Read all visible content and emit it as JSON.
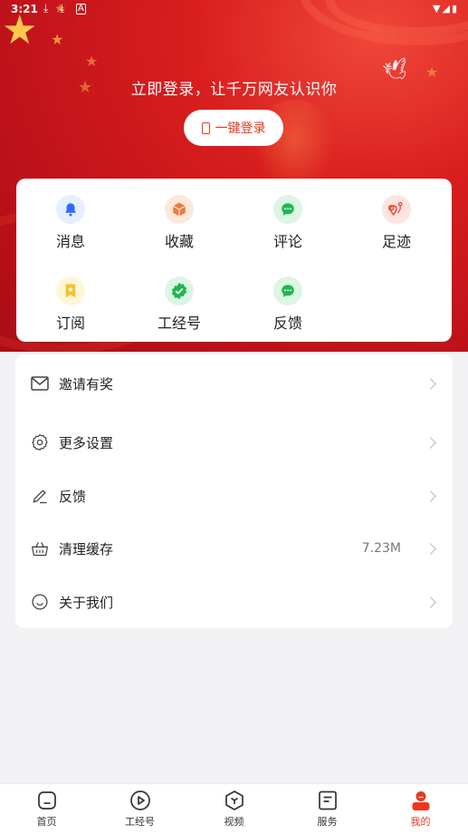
{
  "status_bar": {
    "time": "3:21"
  },
  "header": {
    "login_prompt": "立即登录，让千万网友认识你",
    "login_button": "一键登录"
  },
  "quick_actions": [
    {
      "label": "消息",
      "icon": "bell-icon",
      "color": "#2f6bf5"
    },
    {
      "label": "收藏",
      "icon": "box-icon",
      "color": "#f07a3a"
    },
    {
      "label": "评论",
      "icon": "comment-icon",
      "color": "#1fb84e"
    },
    {
      "label": "足迹",
      "icon": "footprint-icon",
      "color": "#ea4a3a"
    },
    {
      "label": "订阅",
      "icon": "bookmark-icon",
      "color": "#f5c228"
    },
    {
      "label": "工经号",
      "icon": "badge-check-icon",
      "color": "#1fb84e"
    },
    {
      "label": "反馈",
      "icon": "feedback-icon",
      "color": "#1fb84e"
    }
  ],
  "menu": [
    {
      "label": "邀请有奖",
      "icon": "mail-icon",
      "value": ""
    },
    {
      "label": "更多设置",
      "icon": "gear-icon",
      "value": ""
    },
    {
      "label": "反馈",
      "icon": "pen-icon",
      "value": ""
    },
    {
      "label": "清理缓存",
      "icon": "basket-icon",
      "value": "7.23M"
    },
    {
      "label": "关于我们",
      "icon": "smile-icon",
      "value": ""
    }
  ],
  "tabbar": [
    {
      "label": "首页",
      "icon": "home-icon",
      "active": false
    },
    {
      "label": "工经号",
      "icon": "play-circle-icon",
      "active": false
    },
    {
      "label": "视频",
      "icon": "hexagon-icon",
      "active": false
    },
    {
      "label": "服务",
      "icon": "document-icon",
      "active": false
    },
    {
      "label": "我的",
      "icon": "user-icon",
      "active": true
    }
  ],
  "colors": {
    "accent": "#e8391f",
    "hero_red": "#d81e1e"
  }
}
